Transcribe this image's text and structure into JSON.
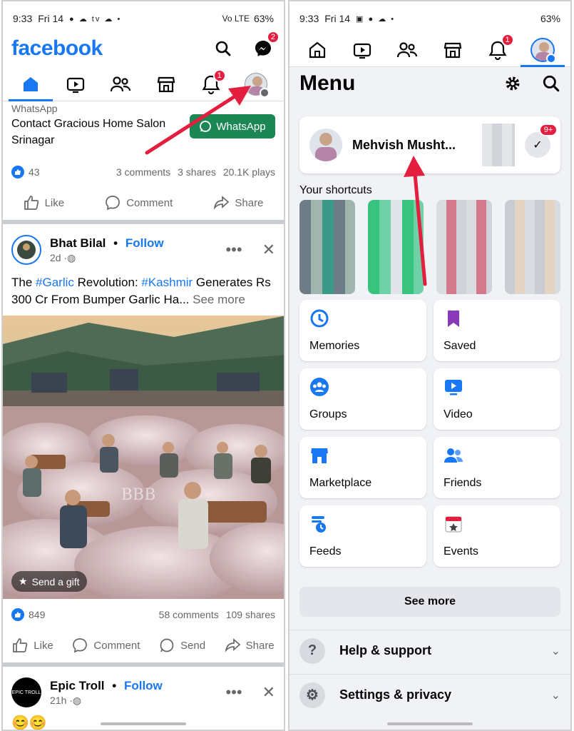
{
  "left": {
    "status": {
      "time": "9:33",
      "day": "Fri 14",
      "notif_icons": "● ☁ tv ☁ •",
      "signal": "Vo LTE",
      "battery": "63%"
    },
    "header": {
      "logo": "facebook",
      "messenger_badge": "2"
    },
    "tabs": [
      "home",
      "video",
      "friends",
      "marketplace",
      "notifications",
      "menu"
    ],
    "notifications_badge": "1",
    "ad": {
      "sponsor": "WhatsApp",
      "title": "Contact Gracious Home Salon Srinagar",
      "cta": "WhatsApp"
    },
    "ad_stats": {
      "likes": "43",
      "comments": "3 comments",
      "shares": "3 shares",
      "plays": "20.1K plays"
    },
    "ad_actions": {
      "like": "Like",
      "comment": "Comment",
      "share": "Share"
    },
    "post": {
      "author": "Bhat Bilal",
      "follow": "Follow",
      "separator": "•",
      "time": "2d",
      "text_before": "The ",
      "hashtag1": "#Garlic",
      "text_mid": " Revolution: ",
      "hashtag2": "#Kashmir",
      "text_after": " Generates Rs 300 Cr From Bumper Garlic Ha...",
      "see_more": "See more",
      "gift": "Send a gift",
      "watermark": "BBB",
      "likes": "849",
      "comments": "58 comments",
      "shares": "109 shares",
      "actions": {
        "like": "Like",
        "comment": "Comment",
        "send": "Send",
        "share": "Share"
      }
    },
    "post2": {
      "author": "Epic Troll",
      "avatar_text": "EPIC TROLL",
      "follow": "Follow",
      "separator": "•",
      "time": "21h",
      "emoji": "😊😊"
    }
  },
  "right": {
    "status": {
      "time": "9:33",
      "day": "Fri 14",
      "battery": "63%"
    },
    "tabs": [
      "home",
      "video",
      "friends",
      "marketplace",
      "notifications",
      "menu"
    ],
    "notifications_badge": "1",
    "title": "Menu",
    "profile": {
      "name": "Mehvish Musht...",
      "badge": "9+"
    },
    "shortcuts_label": "Your shortcuts",
    "tiles": [
      {
        "label": "Memories",
        "icon": "memories-icon",
        "color": "#1877f2"
      },
      {
        "label": "Saved",
        "icon": "saved-icon",
        "color": "#8a3ab9"
      },
      {
        "label": "Groups",
        "icon": "groups-icon",
        "color": "#1877f2"
      },
      {
        "label": "Video",
        "icon": "video-icon",
        "color": "#1877f2"
      },
      {
        "label": "Marketplace",
        "icon": "marketplace-icon",
        "color": "#1877f2"
      },
      {
        "label": "Friends",
        "icon": "friends-icon",
        "color": "#1877f2"
      },
      {
        "label": "Feeds",
        "icon": "feeds-icon",
        "color": "#1877f2"
      },
      {
        "label": "Events",
        "icon": "events-icon",
        "color": "#e41e3f"
      }
    ],
    "see_more": "See more",
    "help": "Help & support",
    "settings": "Settings & privacy"
  },
  "accent": "#1877f2",
  "annotation_arrow_color": "#e41e3f"
}
